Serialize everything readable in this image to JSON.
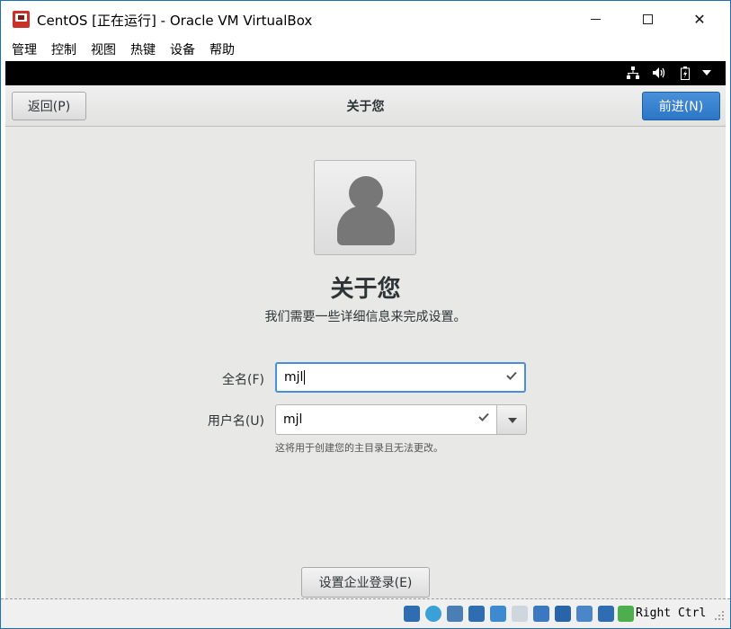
{
  "window": {
    "title": "CentOS [正在运行] - Oracle VM VirtualBox",
    "close_glyph": "✕"
  },
  "menubar": {
    "items": [
      "管理",
      "控制",
      "视图",
      "热键",
      "设备",
      "帮助"
    ]
  },
  "guest_topbar": {
    "icons": [
      "network-icon",
      "volume-icon",
      "battery-icon",
      "dropdown-arrow-icon"
    ]
  },
  "header": {
    "back_label": "返回(P)",
    "title": "关于您",
    "next_label": "前进(N)"
  },
  "main": {
    "heading": "关于您",
    "subtext": "我们需要一些详细信息来完成设置。",
    "full_name_label": "全名(F)",
    "full_name_value": "mjl",
    "username_label": "用户名(U)",
    "username_value": "mjl",
    "username_hint": "这将用于创建您的主目录且无法更改。",
    "enterprise_login_label": "设置企业登录(E)"
  },
  "statusbar": {
    "host_key": "Right Ctrl"
  },
  "colors": {
    "accent": "#4a90d9",
    "window_border": "#1f6fb5"
  }
}
